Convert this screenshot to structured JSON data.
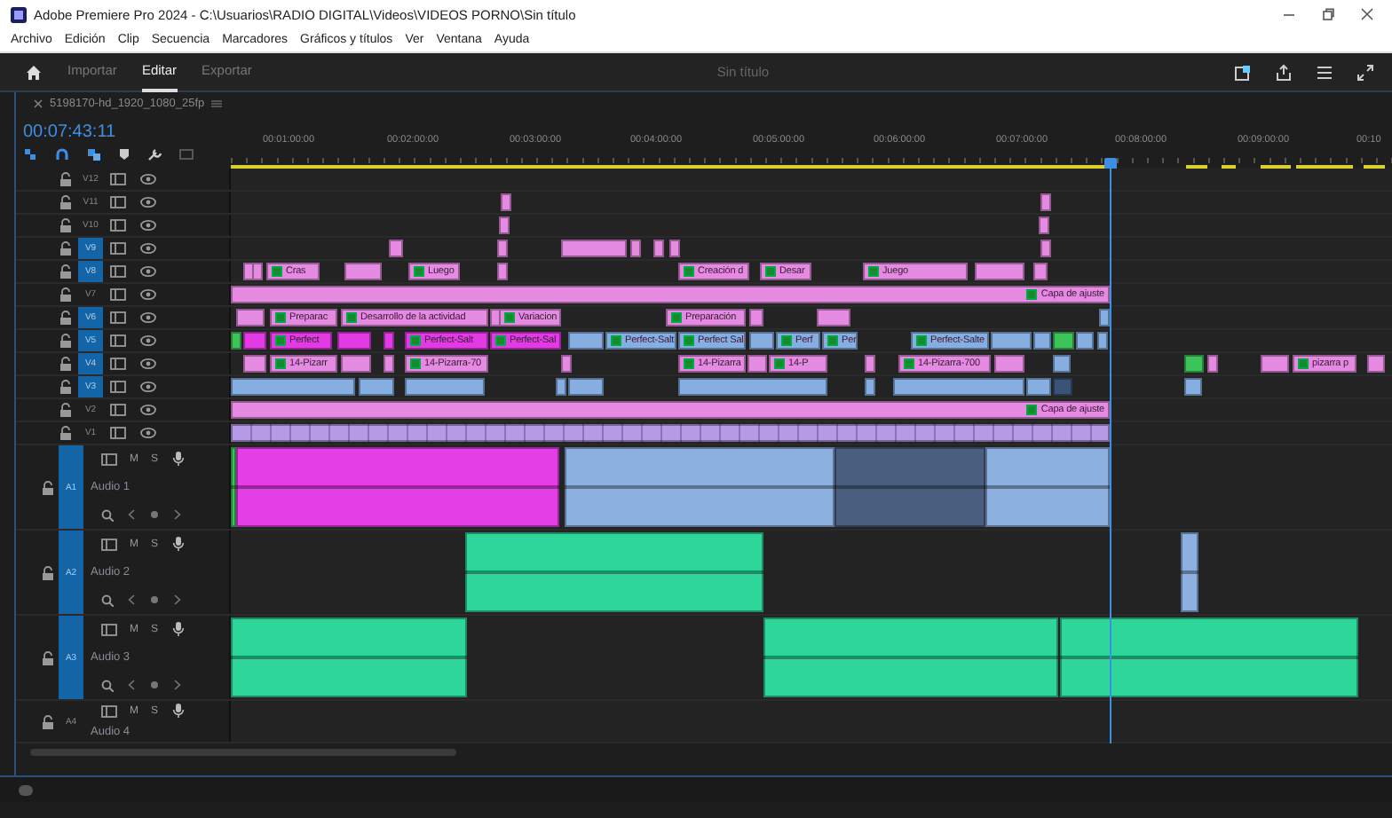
{
  "window": {
    "title": "Adobe Premiere Pro 2024 - C:\\Usuarios\\RADIO DIGITAL\\Videos\\VIDEOS PORNO\\Sin título"
  },
  "menu": [
    "Archivo",
    "Edición",
    "Clip",
    "Secuencia",
    "Marcadores",
    "Gráficos y títulos",
    "Ver",
    "Ventana",
    "Ayuda"
  ],
  "app_bar": {
    "tabs": [
      {
        "label": "Importar",
        "selected": false
      },
      {
        "label": "Editar",
        "selected": true
      },
      {
        "label": "Exportar",
        "selected": false
      }
    ],
    "project_title": "Sin título"
  },
  "sequence": {
    "name": "5198170-hd_1920_1080_25fp",
    "timecode": "00:07:43:11",
    "ruler": [
      "00:01:00:00",
      "00:02:00:00",
      "00:03:00:00",
      "00:04:00:00",
      "00:05:00:00",
      "00:06:00:00",
      "00:07:00:00",
      "00:08:00:00",
      "00:09:00:00",
      "00:10"
    ]
  },
  "video_tracks": [
    {
      "name": "V12",
      "targeted": false
    },
    {
      "name": "V11",
      "targeted": false,
      "clips": [
        {
          "color": "#e48ae0"
        },
        {
          "color": "#e48ae0"
        }
      ]
    },
    {
      "name": "V10",
      "targeted": false,
      "clips": [
        {
          "color": "#e48ae0"
        },
        {
          "color": "#e48ae0"
        }
      ]
    },
    {
      "name": "V9",
      "targeted": true,
      "clips": [
        {
          "color": "#e48ae0"
        },
        {
          "color": "#e48ae0"
        },
        {
          "color": "#e48ae0"
        },
        {
          "color": "#e48ae0"
        },
        {
          "color": "#e48ae0"
        },
        {
          "color": "#e48ae0"
        },
        {
          "color": "#e48ae0"
        }
      ]
    },
    {
      "name": "V8",
      "targeted": true,
      "clips": [
        {
          "color": "#e48ae0"
        },
        {
          "color": "#e48ae0"
        },
        {
          "color": "#e48ae0",
          "label": "Cras"
        },
        {
          "color": "#e48ae0"
        },
        {
          "color": "#e48ae0",
          "label": "Luego"
        },
        {
          "color": "#e48ae0"
        },
        {
          "color": "#e48ae0",
          "label": "Creación d"
        },
        {
          "color": "#e48ae0",
          "label": "Desar"
        },
        {
          "color": "#e48ae0",
          "label": "Juego"
        },
        {
          "color": "#e48ae0"
        },
        {
          "color": "#e48ae0"
        }
      ]
    },
    {
      "name": "V7",
      "targeted": false,
      "clips": [
        {
          "color": "#e48ae0",
          "label": "Capa de ajuste"
        }
      ]
    },
    {
      "name": "V6",
      "targeted": true,
      "clips": [
        {
          "color": "#e48ae0"
        },
        {
          "color": "#e48ae0",
          "label": "Preparac"
        },
        {
          "color": "#e48ae0",
          "label": "Desarrollo de la actividad"
        },
        {
          "color": "#e48ae0"
        },
        {
          "color": "#e48ae0",
          "label": "Variacion"
        },
        {
          "color": "#e48ae0",
          "label": "Preparación"
        },
        {
          "color": "#e48ae0"
        },
        {
          "color": "#e48ae0"
        },
        {
          "color": "#86aee0"
        }
      ]
    },
    {
      "name": "V5",
      "targeted": true,
      "clips": [
        {
          "color": "#3cc35a"
        },
        {
          "color": "#e23be3"
        },
        {
          "color": "#e23be3",
          "label": "Perfect"
        },
        {
          "color": "#e23be3"
        },
        {
          "color": "#e23be3"
        },
        {
          "color": "#e23be3",
          "label": "Perfect-Salt"
        },
        {
          "color": "#e23be3",
          "label": "Perfect-Sal"
        },
        {
          "color": "#86aee0"
        },
        {
          "color": "#86aee0",
          "label": "Perfect-Salt"
        },
        {
          "color": "#86aee0",
          "label": "Perfect Sal"
        },
        {
          "color": "#86aee0"
        },
        {
          "color": "#86aee0",
          "label": "Perf"
        },
        {
          "color": "#86aee0",
          "label": "Per"
        },
        {
          "color": "#86aee0",
          "label": "Perfect-Salte"
        },
        {
          "color": "#86aee0"
        },
        {
          "color": "#86aee0"
        },
        {
          "color": "#3cc35a"
        },
        {
          "color": "#86aee0"
        },
        {
          "color": "#86aee0"
        }
      ]
    },
    {
      "name": "V4",
      "targeted": true,
      "clips": [
        {
          "color": "#e48ae0"
        },
        {
          "color": "#e48ae0",
          "label": "14-Pizarr"
        },
        {
          "color": "#e48ae0"
        },
        {
          "color": "#e48ae0"
        },
        {
          "color": "#e48ae0",
          "label": "14-Pizarra-70"
        },
        {
          "color": "#e48ae0"
        },
        {
          "color": "#e48ae0",
          "label": "14-Pizarra"
        },
        {
          "color": "#e48ae0"
        },
        {
          "color": "#e48ae0",
          "label": "14-P"
        },
        {
          "color": "#e48ae0"
        },
        {
          "color": "#e48ae0",
          "label": "14-Pizarra-700"
        },
        {
          "color": "#e48ae0"
        },
        {
          "color": "#86aee0"
        },
        {
          "color": "#3cc35a"
        },
        {
          "color": "#e48ae0"
        },
        {
          "color": "#e48ae0"
        },
        {
          "color": "#e48ae0",
          "label": "pizarra p"
        },
        {
          "color": "#e48ae0"
        }
      ]
    },
    {
      "name": "V3",
      "targeted": true,
      "clips": [
        {
          "color": "#86aee0"
        },
        {
          "color": "#86aee0"
        },
        {
          "color": "#86aee0"
        },
        {
          "color": "#86aee0"
        },
        {
          "color": "#86aee0"
        },
        {
          "color": "#86aee0"
        },
        {
          "color": "#86aee0"
        },
        {
          "color": "#86aee0"
        },
        {
          "color": "#86aee0"
        },
        {
          "color": "#3b5375"
        },
        {
          "color": "#86aee0"
        }
      ]
    },
    {
      "name": "V2",
      "targeted": false,
      "clips": [
        {
          "color": "#e48ae0",
          "label": "Capa de ajuste"
        }
      ]
    },
    {
      "name": "V1",
      "targeted": false,
      "clips": [
        {
          "color": "#b59be6"
        }
      ]
    }
  ],
  "audio_tracks": [
    {
      "name": "A1",
      "title": "Audio 1",
      "targeted": true,
      "buttons": [
        "M",
        "S"
      ],
      "clips": [
        {
          "color": "#3cc35a"
        },
        {
          "color": "#e43ee6"
        },
        {
          "color": "#8cb0e0"
        },
        {
          "color": "#4a5f7f"
        },
        {
          "color": "#8cb0e0"
        }
      ]
    },
    {
      "name": "A2",
      "title": "Audio 2",
      "targeted": true,
      "buttons": [
        "M",
        "S"
      ],
      "clips": [
        {
          "color": "#2fd69a"
        },
        {
          "color": "#8cb0e0"
        }
      ]
    },
    {
      "name": "A3",
      "title": "Audio 3",
      "targeted": true,
      "buttons": [
        "M",
        "S"
      ],
      "clips": [
        {
          "color": "#2fd69a"
        },
        {
          "color": "#2fd69a"
        },
        {
          "color": "#2fd69a"
        }
      ]
    },
    {
      "name": "A4",
      "title": "Audio 4",
      "targeted": false,
      "buttons": [
        "M",
        "S"
      ]
    }
  ]
}
